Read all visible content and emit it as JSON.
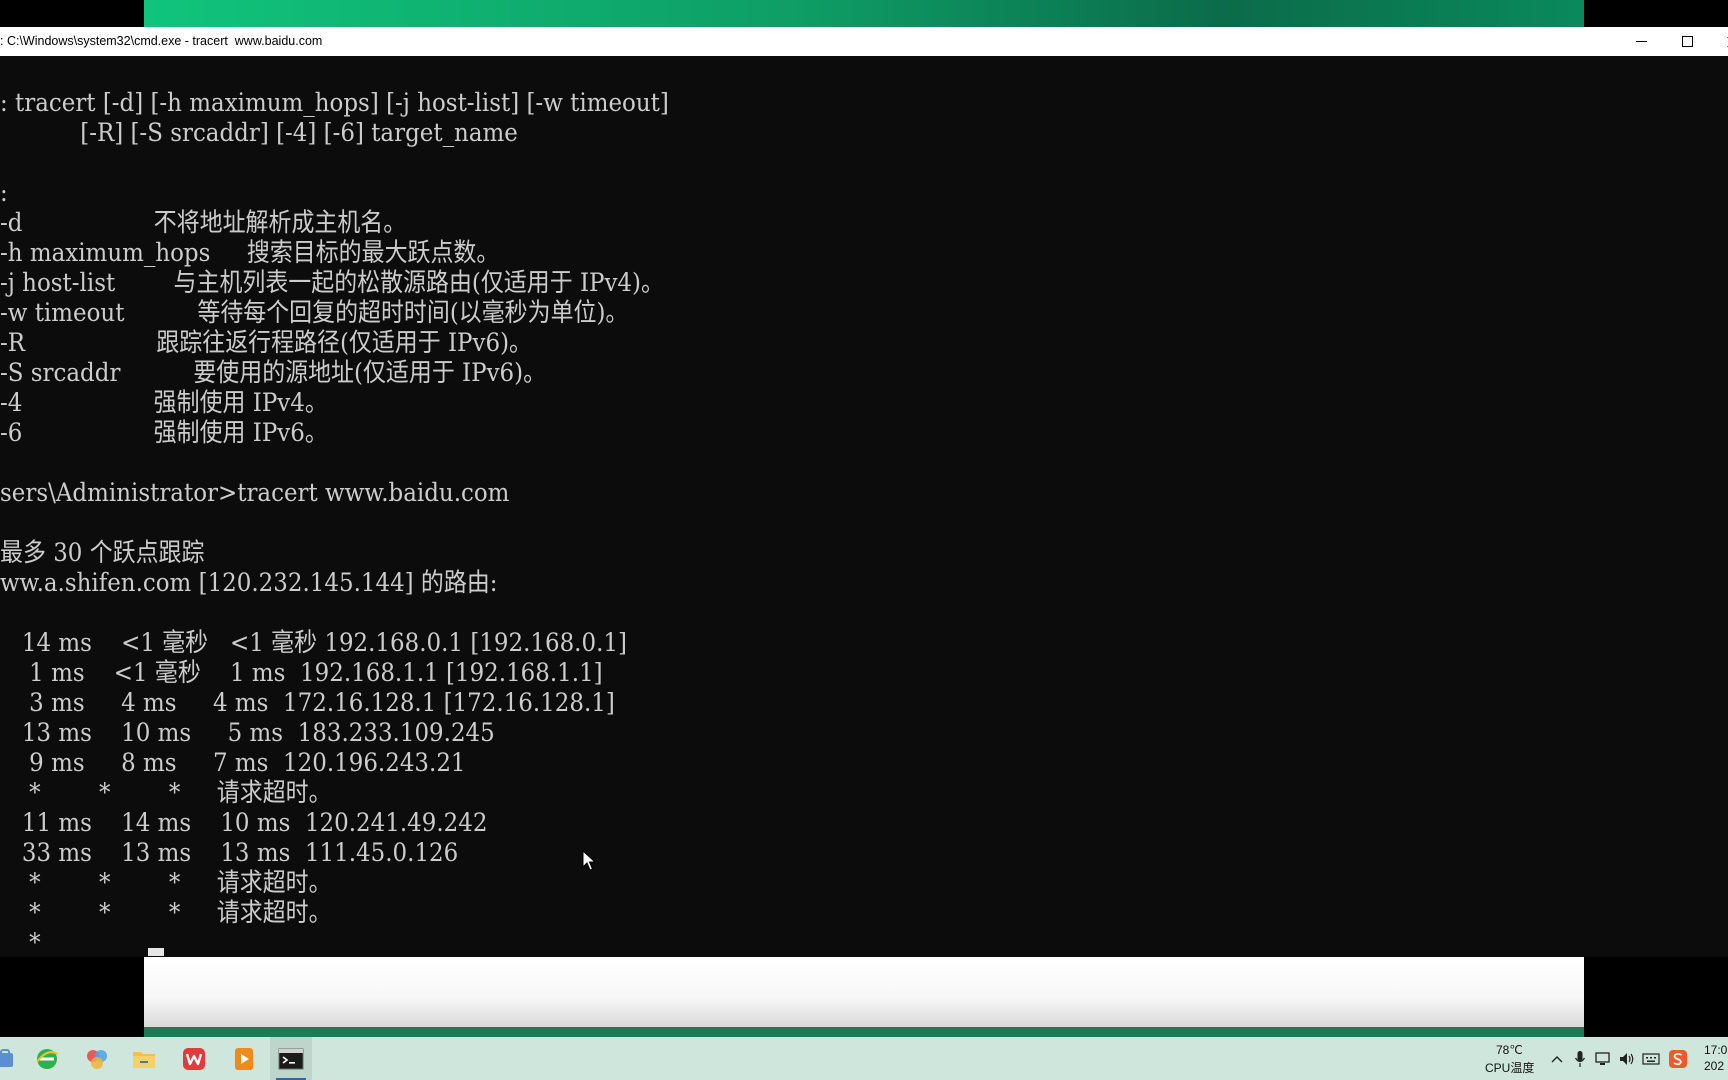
{
  "window": {
    "title": ": C:\\Windows\\system32\\cmd.exe - tracert  www.baidu.com"
  },
  "console": {
    "lines": [
      ": tracert [-d] [-h maximum_hops] [-j host-list] [-w timeout]",
      "           [-R] [-S srcaddr] [-4] [-6] target_name",
      "",
      ":",
      "-d                  不将地址解析成主机名。",
      "-h maximum_hops     搜索目标的最大跃点数。",
      "-j host-list        与主机列表一起的松散源路由(仅适用于 IPv4)。",
      "-w timeout          等待每个回复的超时时间(以毫秒为单位)。",
      "-R                  跟踪往返行程路径(仅适用于 IPv6)。",
      "-S srcaddr          要使用的源地址(仅适用于 IPv6)。",
      "-4                  强制使用 IPv4。",
      "-6                  强制使用 IPv6。",
      "",
      "sers\\Administrator>tracert www.baidu.com",
      "",
      "最多 30 个跃点跟踪",
      "ww.a.shifen.com [120.232.145.144] 的路由:",
      "",
      "   14 ms    <1 毫秒   <1 毫秒 192.168.0.1 [192.168.0.1]",
      "    1 ms    <1 毫秒    1 ms  192.168.1.1 [192.168.1.1]",
      "    3 ms     4 ms     4 ms  172.16.128.1 [172.16.128.1]",
      "   13 ms    10 ms     5 ms  183.233.109.245",
      "    9 ms     8 ms     7 ms  120.196.243.21",
      "    *        *        *     请求超时。",
      "   11 ms    14 ms    10 ms  120.241.49.242",
      "   33 ms    13 ms    13 ms  111.45.0.126",
      "    *        *        *     请求超时。",
      "    *        *        *     请求超时。",
      "    *"
    ]
  },
  "taskbar": {
    "apps": [
      "store-icon",
      "ie-browser-icon",
      "photos-icon",
      "file-explorer-icon",
      "wps-office-icon",
      "media-player-icon",
      "cmd-terminal-icon"
    ],
    "tray": {
      "temp": "78℃",
      "temp_label": "CPU温度",
      "time": "17:0",
      "date": "202"
    }
  },
  "colors": {
    "console_bg": "#0c0c0c",
    "console_text": "#cccccc",
    "taskbar_bg": "#cfe6dc",
    "wallpaper": "#0e9e66"
  }
}
